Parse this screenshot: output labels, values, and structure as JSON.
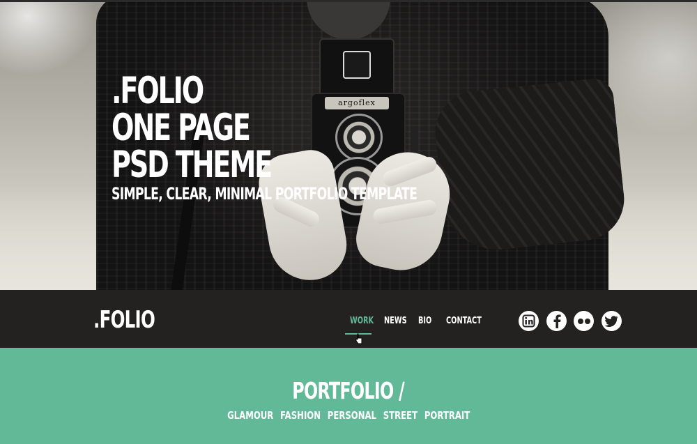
{
  "hero": {
    "line1": ".FOLIO",
    "line2": "ONE PAGE",
    "line3": "PSD THEME",
    "subtitle": "SIMPLE, CLEAR, MINIMAL PORTFOLIO TEMPLATE",
    "camera_brand": "argoflex"
  },
  "nav": {
    "logo": ".FOLIO",
    "items": [
      {
        "label": "WORK",
        "active": true
      },
      {
        "label": "NEWS",
        "active": false
      },
      {
        "label": "BIO",
        "active": false
      },
      {
        "label": "CONTACT",
        "active": false
      }
    ],
    "social": [
      {
        "name": "linkedin-icon"
      },
      {
        "name": "facebook-icon"
      },
      {
        "name": "flickr-icon"
      },
      {
        "name": "twitter-icon"
      }
    ]
  },
  "portfolio": {
    "title": "PORTFOLIO /",
    "filters": [
      "GLAMOUR",
      "FASHION",
      "PERSONAL",
      "STREET",
      "PORTRAIT"
    ]
  },
  "colors": {
    "accent": "#62b997",
    "navbar_bg": "#232221",
    "text": "#ffffff"
  }
}
